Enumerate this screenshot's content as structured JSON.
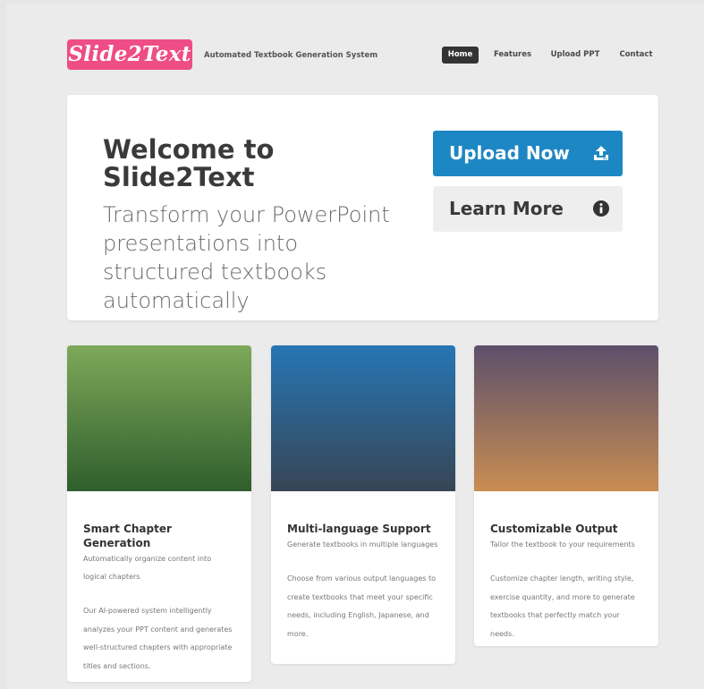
{
  "header": {
    "logo": "Slide2Text",
    "tagline": "Automated Textbook Generation System",
    "nav": [
      "Home",
      "Features",
      "Upload PPT",
      "Contact"
    ],
    "active_nav": "Home"
  },
  "hero": {
    "title": "Welcome to Slide2Text",
    "subtitle": "Transform your PowerPoint presentations into structured textbooks automatically",
    "upload_label": "Upload Now",
    "learn_label": "Learn More"
  },
  "cards": [
    {
      "title": "Smart Chapter Generation",
      "lead": "Automatically organize content into logical chapters",
      "desc": "Our AI-powered system intelligently analyzes your PPT content and generates well-structured chapters with appropriate titles and sections."
    },
    {
      "title": "Multi-language Support",
      "lead": "Generate textbooks in multiple languages",
      "desc": "Choose from various output languages to create textbooks that meet your specific needs, including English, Japanese, and more."
    },
    {
      "title": "Customizable Output",
      "lead": "Tailor the textbook to your requirements",
      "desc": "Customize chapter length, writing style, exercise quantity, and more to generate textbooks that perfectly match your needs."
    }
  ],
  "colors": {
    "brand": "#ee4d85",
    "primary_button": "#1d87c4",
    "nav_active": "#333333"
  },
  "icons": {
    "upload": "upload-icon",
    "info": "info-icon"
  }
}
